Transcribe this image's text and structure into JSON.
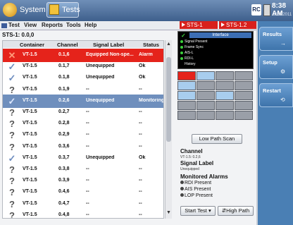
{
  "system": {
    "system_label": "System",
    "tests_label": "Tests",
    "rc_badge": "RC",
    "time": "8:38 AM",
    "date": "3/28/2011"
  },
  "menu": {
    "items": [
      "Test",
      "View",
      "Reports",
      "Tools",
      "Help"
    ]
  },
  "tabs": [
    "STS-1",
    "STS-1.2"
  ],
  "table": {
    "sts_label": "STS-1: 0.0,0",
    "headers": [
      "Container",
      "Channel",
      "Signal Label",
      "Status"
    ],
    "rows": [
      {
        "icon": "x-icon",
        "container": "VT-1.5",
        "channel": "0.1,6",
        "signal": "Equipped Non-spe...",
        "status": "Alarm",
        "state": "alarm"
      },
      {
        "icon": "check-icon",
        "container": "VT-1.5",
        "channel": "0.1,7",
        "signal": "Unequipped",
        "status": "Ok",
        "state": ""
      },
      {
        "icon": "check-icon",
        "container": "VT-1.5",
        "channel": "0.1,8",
        "signal": "Unequipped",
        "status": "Ok",
        "state": ""
      },
      {
        "icon": "question-icon",
        "container": "VT-1.5",
        "channel": "0.1,9",
        "signal": "--",
        "status": "--",
        "state": ""
      },
      {
        "icon": "check-icon",
        "container": "VT-1.5",
        "channel": "0.2,6",
        "signal": "Unequipped",
        "status": "Monitoring",
        "state": "sel"
      },
      {
        "icon": "question-icon",
        "container": "VT-1.5",
        "channel": "0.2,7",
        "signal": "--",
        "status": "--",
        "state": ""
      },
      {
        "icon": "question-icon",
        "container": "VT-1.5",
        "channel": "0.2,8",
        "signal": "--",
        "status": "--",
        "state": ""
      },
      {
        "icon": "question-icon",
        "container": "VT-1.5",
        "channel": "0.2,9",
        "signal": "--",
        "status": "--",
        "state": ""
      },
      {
        "icon": "question-icon",
        "container": "VT-1.5",
        "channel": "0.3,6",
        "signal": "--",
        "status": "--",
        "state": ""
      },
      {
        "icon": "check-icon",
        "container": "VT-1.5",
        "channel": "0.3,7",
        "signal": "Unequipped",
        "status": "Ok",
        "state": ""
      },
      {
        "icon": "question-icon",
        "container": "VT-1.5",
        "channel": "0.3,8",
        "signal": "--",
        "status": "--",
        "state": ""
      },
      {
        "icon": "question-icon",
        "container": "VT-1.5",
        "channel": "0.3,9",
        "signal": "--",
        "status": "--",
        "state": ""
      },
      {
        "icon": "question-icon",
        "container": "VT-1.5",
        "channel": "0.4,6",
        "signal": "--",
        "status": "--",
        "state": ""
      },
      {
        "icon": "question-icon",
        "container": "VT-1.5",
        "channel": "0.4,7",
        "signal": "--",
        "status": "--",
        "state": ""
      },
      {
        "icon": "question-icon",
        "container": "VT-1.5",
        "channel": "0.4,8",
        "signal": "--",
        "status": "--",
        "state": ""
      }
    ]
  },
  "interface": {
    "title": "Interface",
    "legend": [
      "Signal Present",
      "Frame Sync",
      "AIS-L",
      "RDI-L",
      "History"
    ]
  },
  "path_scan": {
    "button_label": "Low Path Scan"
  },
  "details": {
    "channel_title": "Channel",
    "channel_value": "VT-1.5: 0.2,6",
    "signal_title": "Signal Label",
    "signal_value": "Unequipped",
    "alarms_title": "Monitored Alarms",
    "alarms": [
      "RDI Present",
      "AIS Present",
      "LOP Present"
    ]
  },
  "bottom": {
    "start_test": "Start Test",
    "high_path": "High Path"
  },
  "side": {
    "results": "Results",
    "setup": "Setup",
    "restart": "Restart"
  },
  "colors": {
    "alarm_row": "#e5231b",
    "selected_row": "#6f8fbd",
    "side_panel": "#4a7fb4"
  }
}
